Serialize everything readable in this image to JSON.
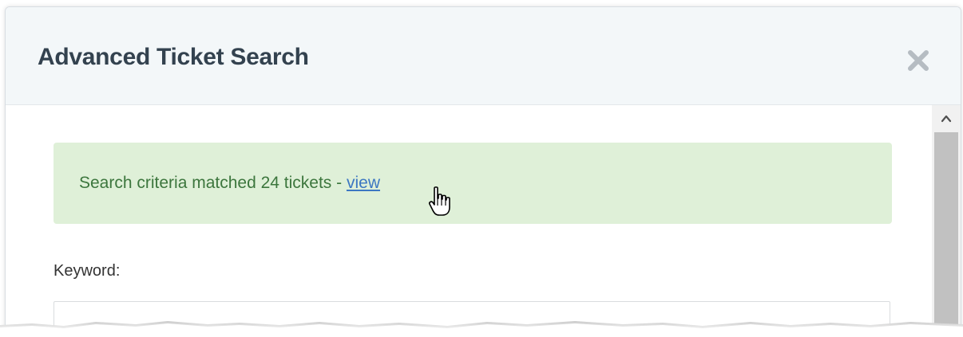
{
  "dialog": {
    "title": "Advanced Ticket Search",
    "close_icon": "close-icon"
  },
  "alert": {
    "text": "Search criteria matched 24 tickets - ",
    "link_label": "view",
    "background_color": "#dff0d8",
    "text_color": "#3c763d",
    "link_color": "#3c77c2"
  },
  "form": {
    "keyword_label": "Keyword:",
    "keyword_value": ""
  },
  "scrollbar": {
    "up_icon": "chevron-up-icon"
  },
  "cursor": {
    "icon": "hand-pointer-icon"
  }
}
